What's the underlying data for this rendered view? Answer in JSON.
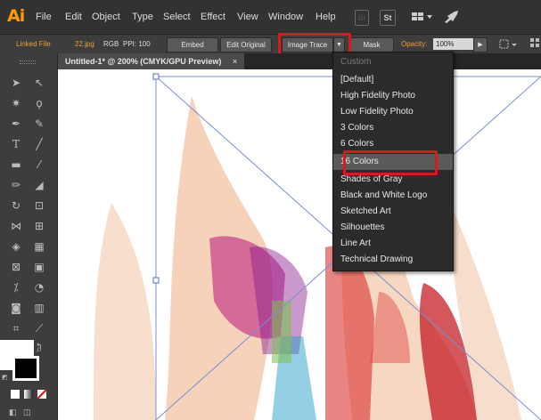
{
  "app": {
    "logo": "Ai"
  },
  "menu": [
    "File",
    "Edit",
    "Object",
    "Type",
    "Select",
    "Effect",
    "View",
    "Window",
    "Help"
  ],
  "menubar_icons": {
    "br_label": "Br",
    "st_label": "St"
  },
  "controlbar": {
    "linked_file": "Linked File",
    "file_name": "22.jpg",
    "color_mode": "RGB",
    "ppi": "PPI: 100",
    "embed": "Embed",
    "edit_original": "Edit Original",
    "image_trace": "Image Trace",
    "mask": "Mask",
    "opacity_label": "Opacity:",
    "opacity_value": "100%"
  },
  "document_tab": {
    "title": "Untitled-1* @ 200% (CMYK/GPU Preview)",
    "close": "×"
  },
  "dropdown": {
    "header": "Custom",
    "items": [
      "[Default]",
      "High Fidelity Photo",
      "Low Fidelity Photo",
      "3 Colors",
      "6 Colors",
      "16 Colors",
      "Shades of Gray",
      "Black and White Logo",
      "Sketched Art",
      "Silhouettes",
      "Line Art",
      "Technical Drawing"
    ],
    "selected": "16 Colors"
  },
  "colors": {
    "highlight_box": "#e0161c",
    "accent": "#ff9a00"
  }
}
